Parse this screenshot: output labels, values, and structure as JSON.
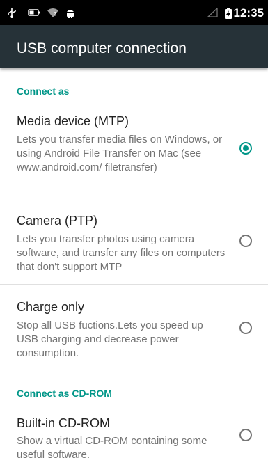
{
  "status_bar": {
    "time": "12:35",
    "icons": [
      "usb-icon",
      "battery-small-icon",
      "wifi-question-icon",
      "android-icon",
      "signal-icon",
      "battery-charging-icon"
    ]
  },
  "app_bar": {
    "title": "USB computer connection"
  },
  "sections": [
    {
      "header": "Connect as",
      "items": [
        {
          "title": "Media device (MTP)",
          "summary": "Lets you transfer media files on Windows, or using Android File Transfer on Mac (see www.android.com/ filetransfer)",
          "selected": true
        },
        {
          "title": "Camera (PTP)",
          "summary": "Lets you transfer photos using camera software, and transfer any files on computers that don't support MTP",
          "selected": false
        },
        {
          "title": "Charge only",
          "summary": "Stop all USB fuctions.Lets you speed up USB charging and decrease power consumption.",
          "selected": false
        }
      ]
    },
    {
      "header": "Connect as CD-ROM",
      "items": [
        {
          "title": "Built-in CD-ROM",
          "summary": "Show a virtual CD-ROM containing some useful software.",
          "selected": false
        }
      ]
    }
  ],
  "colors": {
    "accent": "#009688",
    "app_bar": "#263238",
    "status_bar": "#000000"
  }
}
